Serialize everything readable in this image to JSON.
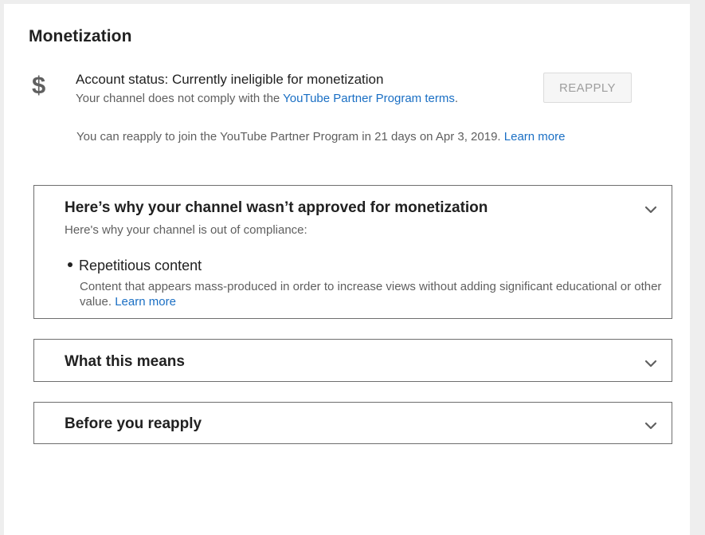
{
  "header": {
    "title": "Monetization"
  },
  "account_status": {
    "icon": "dollar-icon",
    "icon_glyph": "$",
    "title": "Account status: Currently ineligible for monetization",
    "sub_prefix": "Your channel does not comply with the ",
    "sub_link": "YouTube Partner Program terms",
    "sub_suffix": ".",
    "reapply_label": "REAPPLY",
    "note_text": "You can reapply to join the YouTube Partner Program in 21 days on Apr 3, 2019.",
    "note_link": "Learn more"
  },
  "panels": [
    {
      "title": "Here’s why your channel wasn’t approved for monetization",
      "subtitle": "Here's why your channel is out of compliance:",
      "items": [
        {
          "title": "Repetitious content",
          "description": "Content that appears mass-produced in order to increase views without adding significant educational or other value.",
          "link": "Learn more"
        }
      ]
    },
    {
      "title": "What this means"
    },
    {
      "title": "Before you reapply"
    }
  ],
  "colors": {
    "link": "#1a6fc4",
    "primary_text": "#212121",
    "secondary_text": "#5f5f5f",
    "background": "#eeeeee"
  }
}
